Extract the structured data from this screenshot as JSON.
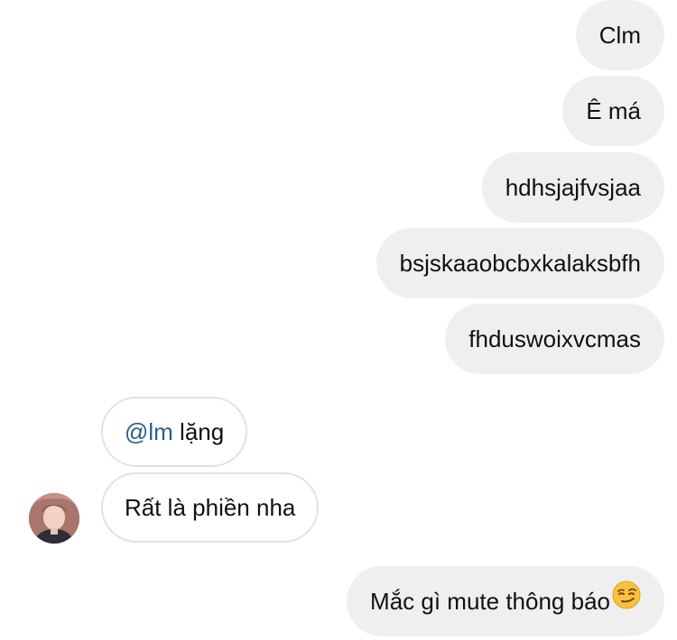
{
  "thread": {
    "outgoing_top": [
      "Clm",
      "Ê má",
      "hdhsjajfvsjaa",
      "bsjskaaobcbxkalaksbfh",
      "fhduswoixvcmas"
    ],
    "incoming": {
      "reply_mention": "@lm",
      "reply_text": " lặng",
      "message": "Rất là phiền nha",
      "avatar_icon": "user-avatar"
    },
    "outgoing_last": {
      "text": "Mắc gì mute thông báo",
      "emoji_icon": "smirking-face-emoji"
    }
  },
  "colors": {
    "outgoing_bubble": "#efefef",
    "incoming_border": "#e2e2e2",
    "mention": "#2a5d8a",
    "text": "#111111"
  }
}
